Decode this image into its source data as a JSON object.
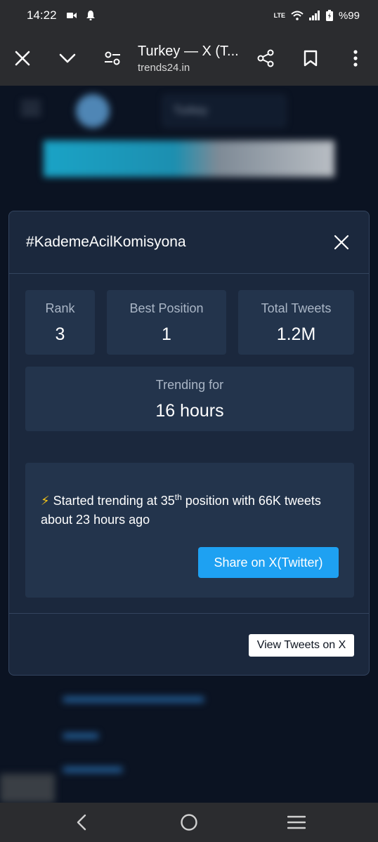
{
  "status_bar": {
    "time": "14:22",
    "battery": "%99",
    "network": "LTE"
  },
  "browser": {
    "tab_title": "Turkey — X (T...",
    "domain": "trends24.in"
  },
  "background": {
    "country_select": "Turkey"
  },
  "modal": {
    "title": "#KademeAcilKomisyona",
    "stats": [
      {
        "label": "Rank",
        "value": "3"
      },
      {
        "label": "Best Position",
        "value": "1"
      },
      {
        "label": "Total Tweets",
        "value": "1.2M"
      }
    ],
    "trending": {
      "label": "Trending for",
      "value": "16 hours"
    },
    "info": {
      "icon": "⚡",
      "text_before": " Started trending at 35",
      "sup": "th",
      "text_after": " position with 66K tweets about 23 hours ago"
    },
    "share_label": "Share on X(Twitter)",
    "view_tweets_label": "View Tweets on X"
  },
  "colors": {
    "modal_bg": "#1b283d",
    "card_bg": "#23344c",
    "accent": "#1ea1f2"
  }
}
